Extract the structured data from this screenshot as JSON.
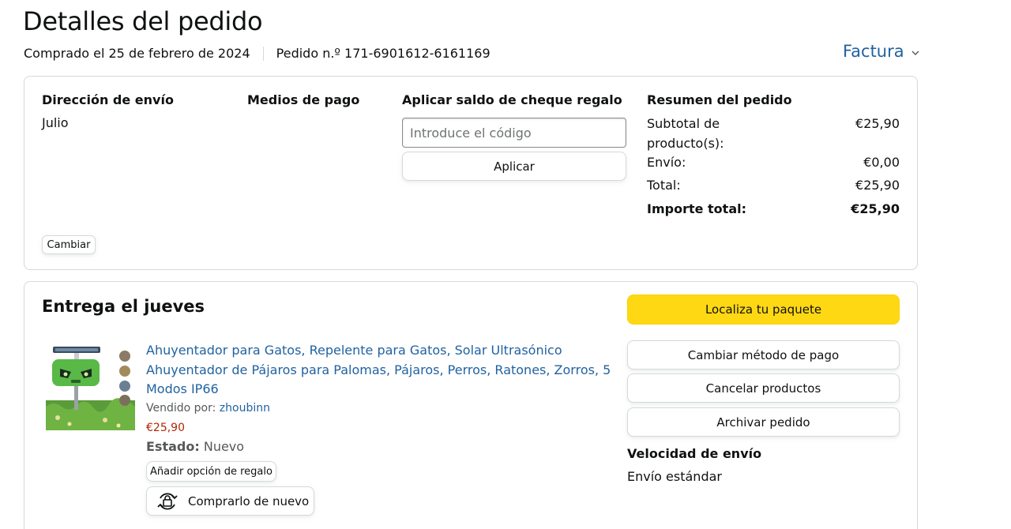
{
  "header": {
    "title": "Detalles del pedido",
    "purchased": "Comprado el 25 de febrero de 2024",
    "order_number": "Pedido n.º 171-6901612-6161169",
    "invoice_label": "Factura",
    "invoice_icon": "chevron-down-icon"
  },
  "summary_card": {
    "shipping": {
      "heading": "Dirección de envío",
      "name": "Julio",
      "change_label": "Cambiar"
    },
    "payment": {
      "heading": "Medios de pago"
    },
    "gift": {
      "heading": "Aplicar saldo de cheque regalo",
      "placeholder": "Introduce el código",
      "value": "",
      "apply_label": "Aplicar"
    },
    "order_summary": {
      "heading": "Resumen del pedido",
      "rows": [
        {
          "label": "Subtotal de producto(s):",
          "value": "€25,90"
        },
        {
          "label": "Envío:",
          "value": "€0,00"
        },
        {
          "label": "Total:",
          "value": "€25,90"
        },
        {
          "label": "Importe total:",
          "value": "€25,90"
        }
      ]
    }
  },
  "delivery_card": {
    "title": "Entrega el jueves",
    "product": {
      "title": "Ahuyentador para Gatos, Repelente para Gatos, Solar Ultrasónico Ahuyentador de Pájaros para Palomas, Pájaros, Perros, Ratones, Zorros, 5 Modos IP66",
      "sold_by_label": "Vendido por:",
      "seller": "zhoubinn",
      "price": "€25,90",
      "state_label": "Estado:",
      "state_value": "Nuevo",
      "gift_option_label": "Añadir opción de regalo",
      "rebuy_label": "Comprarlo de nuevo",
      "rebuy_icon": "rebuy-icon"
    },
    "actions": {
      "track": "Localiza tu paquete",
      "change_payment": "Cambiar método de pago",
      "cancel": "Cancelar productos",
      "archive": "Archivar pedido"
    },
    "shipping_speed": {
      "heading": "Velocidad de envío",
      "value": "Envío estándar"
    }
  },
  "colors": {
    "link": "#2162a1",
    "price": "#b12704",
    "primary_button": "#ffd814",
    "border": "#d5d9d9"
  }
}
